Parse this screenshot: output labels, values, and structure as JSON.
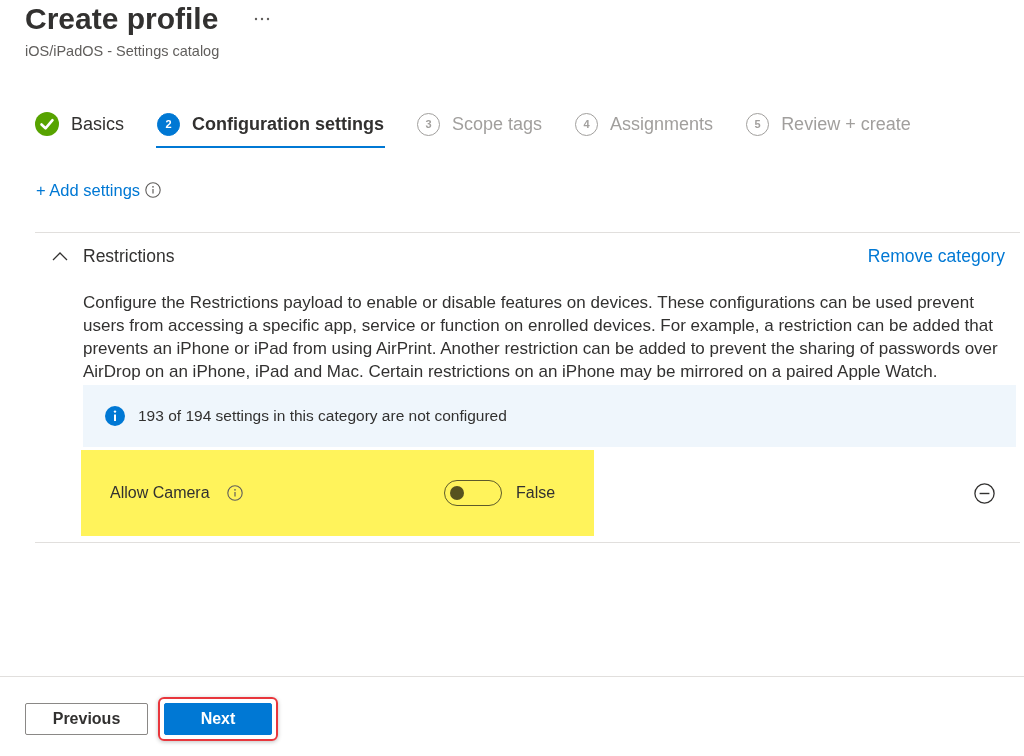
{
  "header": {
    "title": "Create profile",
    "subtitle": "iOS/iPadOS - Settings catalog"
  },
  "steps": [
    {
      "label": "Basics",
      "completed": true,
      "selected": false
    },
    {
      "number": "2",
      "label": "Configuration settings",
      "completed": false,
      "selected": true
    },
    {
      "number": "3",
      "label": "Scope tags",
      "completed": false,
      "selected": false
    },
    {
      "number": "4",
      "label": "Assignments",
      "completed": false,
      "selected": false
    },
    {
      "number": "5",
      "label": "Review + create",
      "completed": false,
      "selected": false
    }
  ],
  "add_settings": {
    "label": "+ Add settings"
  },
  "category": {
    "title": "Restrictions",
    "expanded": true,
    "remove_label": "Remove category",
    "description": "Configure the Restrictions payload to enable or disable features on devices. These configurations can be used prevent users from accessing a specific app, service or function on enrolled devices. For example, a restriction can be added that prevents an iPhone or iPad from using AirPrint. Another restriction can be added to prevent the sharing of passwords over AirDrop on an iPhone, iPad and Mac. Certain restrictions on an iPhone may be mirrored on a paired Apple Watch.",
    "notice": "193 of 194 settings in this category are not configured",
    "settings": [
      {
        "label": "Allow Camera",
        "on": false,
        "value": "False",
        "highlighted": true
      }
    ]
  },
  "footer": {
    "buttons": [
      {
        "label": "Previous",
        "kind": "secondary",
        "highlighted": false
      },
      {
        "label": "Next",
        "kind": "primary",
        "highlighted": true
      }
    ]
  }
}
